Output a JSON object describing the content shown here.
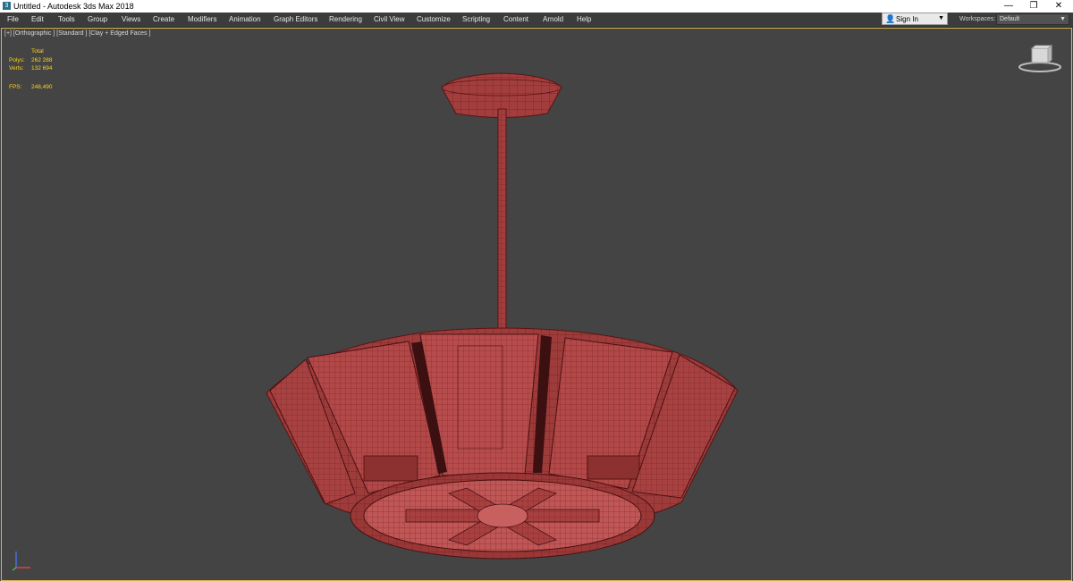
{
  "window": {
    "title": "Untitled - Autodesk 3ds Max 2018",
    "minimize_glyph": "—",
    "restore_glyph": "❐",
    "close_glyph": "✕"
  },
  "menu": {
    "items": [
      "File",
      "Edit",
      "Tools",
      "Group",
      "Views",
      "Create",
      "Modifiers",
      "Animation",
      "Graph Editors",
      "Rendering",
      "Civil View",
      "Customize",
      "Scripting",
      "Content",
      "Arnold",
      "Help"
    ]
  },
  "account": {
    "sign_in_label": "Sign In",
    "workspaces_label": "Workspaces:",
    "workspace_value": "Default"
  },
  "viewport": {
    "label": "[+] [Orthographic ] [Standard ] [Clay + Edged Faces ]",
    "stats": {
      "total_label": "Total",
      "polys_label": "Polys:",
      "polys_value": "262 288",
      "verts_label": "Verts:",
      "verts_value": "132 694",
      "fps_label": "FPS:",
      "fps_value": "248,490"
    }
  },
  "colors": {
    "model_fill": "#a84040",
    "model_wire": "#5a1414",
    "viewport_bg": "#444444",
    "stats_text": "#ffd319",
    "viewport_border": "#d7b450"
  }
}
